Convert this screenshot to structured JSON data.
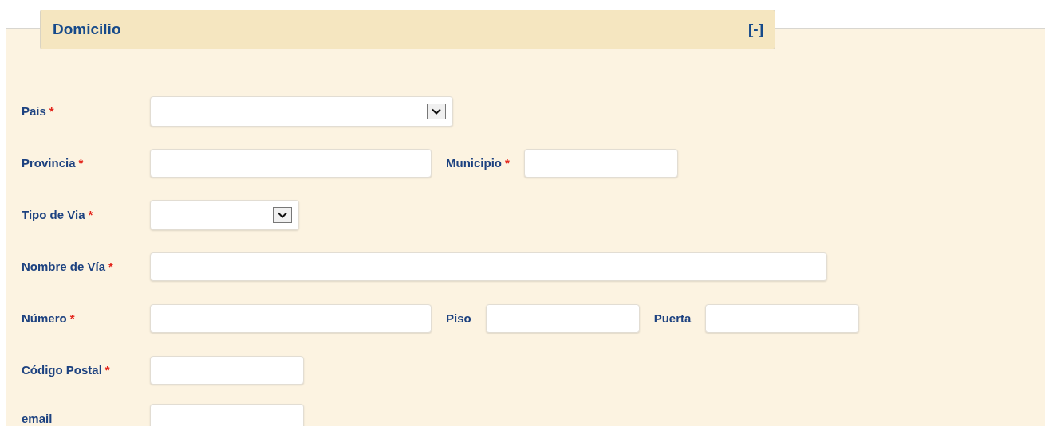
{
  "section": {
    "title": "Domicilio",
    "toggle": "[-]"
  },
  "rows": [
    {
      "fields": [
        {
          "label": "Pais",
          "required_mark": "*",
          "kind": "select"
        }
      ]
    },
    {
      "fields": [
        {
          "label": "Provincia",
          "required_mark": "*",
          "kind": "text"
        },
        {
          "label": "Municipio",
          "required_mark": "*",
          "kind": "text"
        }
      ]
    },
    {
      "fields": [
        {
          "label": "Tipo de Via",
          "required_mark": "*",
          "kind": "select"
        }
      ]
    },
    {
      "fields": [
        {
          "label": "Nombre de Vía",
          "required_mark": "*",
          "kind": "text"
        }
      ]
    },
    {
      "fields": [
        {
          "label": "Número",
          "required_mark": "*",
          "kind": "text"
        },
        {
          "label": "Piso",
          "kind": "text"
        },
        {
          "label": "Puerta",
          "kind": "text"
        }
      ]
    },
    {
      "fields": [
        {
          "label": "Código Postal",
          "required_mark": "*",
          "kind": "text"
        }
      ]
    },
    {
      "fields": [
        {
          "label": "email",
          "kind": "text"
        }
      ]
    }
  ]
}
